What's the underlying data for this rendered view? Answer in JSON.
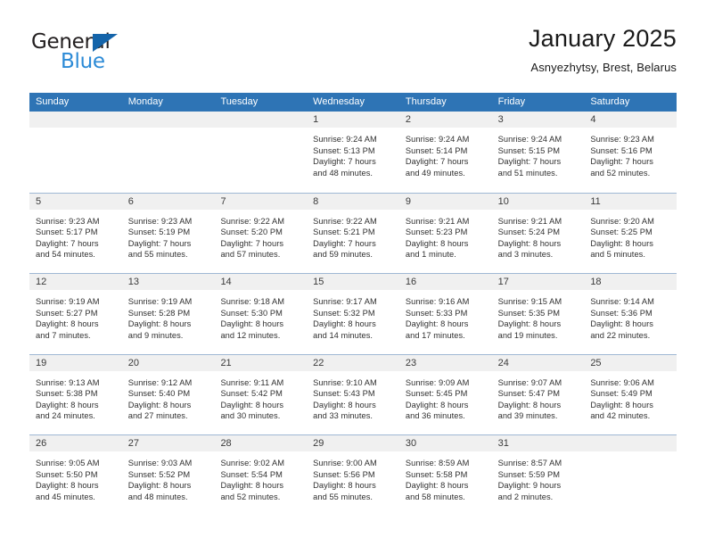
{
  "brand": {
    "name_part1": "General",
    "name_part2": "Blue",
    "triangle_color": "#1464aa",
    "blue_color": "#2b8ad6"
  },
  "header": {
    "title": "January 2025",
    "subtitle": "Asnyezhytsy, Brest, Belarus"
  },
  "theme": {
    "header_bar": "#2e74b5",
    "row_divider": "#9fb8d4",
    "daynum_strip": "#f0f0f0",
    "text": "#303030"
  },
  "weekdays": [
    "Sunday",
    "Monday",
    "Tuesday",
    "Wednesday",
    "Thursday",
    "Friday",
    "Saturday"
  ],
  "weeks": [
    {
      "days": [
        {
          "num": "",
          "lines": []
        },
        {
          "num": "",
          "lines": []
        },
        {
          "num": "",
          "lines": []
        },
        {
          "num": "1",
          "lines": [
            "Sunrise: 9:24 AM",
            "Sunset: 5:13 PM",
            "Daylight: 7 hours",
            "and 48 minutes."
          ]
        },
        {
          "num": "2",
          "lines": [
            "Sunrise: 9:24 AM",
            "Sunset: 5:14 PM",
            "Daylight: 7 hours",
            "and 49 minutes."
          ]
        },
        {
          "num": "3",
          "lines": [
            "Sunrise: 9:24 AM",
            "Sunset: 5:15 PM",
            "Daylight: 7 hours",
            "and 51 minutes."
          ]
        },
        {
          "num": "4",
          "lines": [
            "Sunrise: 9:23 AM",
            "Sunset: 5:16 PM",
            "Daylight: 7 hours",
            "and 52 minutes."
          ]
        }
      ]
    },
    {
      "days": [
        {
          "num": "5",
          "lines": [
            "Sunrise: 9:23 AM",
            "Sunset: 5:17 PM",
            "Daylight: 7 hours",
            "and 54 minutes."
          ]
        },
        {
          "num": "6",
          "lines": [
            "Sunrise: 9:23 AM",
            "Sunset: 5:19 PM",
            "Daylight: 7 hours",
            "and 55 minutes."
          ]
        },
        {
          "num": "7",
          "lines": [
            "Sunrise: 9:22 AM",
            "Sunset: 5:20 PM",
            "Daylight: 7 hours",
            "and 57 minutes."
          ]
        },
        {
          "num": "8",
          "lines": [
            "Sunrise: 9:22 AM",
            "Sunset: 5:21 PM",
            "Daylight: 7 hours",
            "and 59 minutes."
          ]
        },
        {
          "num": "9",
          "lines": [
            "Sunrise: 9:21 AM",
            "Sunset: 5:23 PM",
            "Daylight: 8 hours",
            "and 1 minute."
          ]
        },
        {
          "num": "10",
          "lines": [
            "Sunrise: 9:21 AM",
            "Sunset: 5:24 PM",
            "Daylight: 8 hours",
            "and 3 minutes."
          ]
        },
        {
          "num": "11",
          "lines": [
            "Sunrise: 9:20 AM",
            "Sunset: 5:25 PM",
            "Daylight: 8 hours",
            "and 5 minutes."
          ]
        }
      ]
    },
    {
      "days": [
        {
          "num": "12",
          "lines": [
            "Sunrise: 9:19 AM",
            "Sunset: 5:27 PM",
            "Daylight: 8 hours",
            "and 7 minutes."
          ]
        },
        {
          "num": "13",
          "lines": [
            "Sunrise: 9:19 AM",
            "Sunset: 5:28 PM",
            "Daylight: 8 hours",
            "and 9 minutes."
          ]
        },
        {
          "num": "14",
          "lines": [
            "Sunrise: 9:18 AM",
            "Sunset: 5:30 PM",
            "Daylight: 8 hours",
            "and 12 minutes."
          ]
        },
        {
          "num": "15",
          "lines": [
            "Sunrise: 9:17 AM",
            "Sunset: 5:32 PM",
            "Daylight: 8 hours",
            "and 14 minutes."
          ]
        },
        {
          "num": "16",
          "lines": [
            "Sunrise: 9:16 AM",
            "Sunset: 5:33 PM",
            "Daylight: 8 hours",
            "and 17 minutes."
          ]
        },
        {
          "num": "17",
          "lines": [
            "Sunrise: 9:15 AM",
            "Sunset: 5:35 PM",
            "Daylight: 8 hours",
            "and 19 minutes."
          ]
        },
        {
          "num": "18",
          "lines": [
            "Sunrise: 9:14 AM",
            "Sunset: 5:36 PM",
            "Daylight: 8 hours",
            "and 22 minutes."
          ]
        }
      ]
    },
    {
      "days": [
        {
          "num": "19",
          "lines": [
            "Sunrise: 9:13 AM",
            "Sunset: 5:38 PM",
            "Daylight: 8 hours",
            "and 24 minutes."
          ]
        },
        {
          "num": "20",
          "lines": [
            "Sunrise: 9:12 AM",
            "Sunset: 5:40 PM",
            "Daylight: 8 hours",
            "and 27 minutes."
          ]
        },
        {
          "num": "21",
          "lines": [
            "Sunrise: 9:11 AM",
            "Sunset: 5:42 PM",
            "Daylight: 8 hours",
            "and 30 minutes."
          ]
        },
        {
          "num": "22",
          "lines": [
            "Sunrise: 9:10 AM",
            "Sunset: 5:43 PM",
            "Daylight: 8 hours",
            "and 33 minutes."
          ]
        },
        {
          "num": "23",
          "lines": [
            "Sunrise: 9:09 AM",
            "Sunset: 5:45 PM",
            "Daylight: 8 hours",
            "and 36 minutes."
          ]
        },
        {
          "num": "24",
          "lines": [
            "Sunrise: 9:07 AM",
            "Sunset: 5:47 PM",
            "Daylight: 8 hours",
            "and 39 minutes."
          ]
        },
        {
          "num": "25",
          "lines": [
            "Sunrise: 9:06 AM",
            "Sunset: 5:49 PM",
            "Daylight: 8 hours",
            "and 42 minutes."
          ]
        }
      ]
    },
    {
      "days": [
        {
          "num": "26",
          "lines": [
            "Sunrise: 9:05 AM",
            "Sunset: 5:50 PM",
            "Daylight: 8 hours",
            "and 45 minutes."
          ]
        },
        {
          "num": "27",
          "lines": [
            "Sunrise: 9:03 AM",
            "Sunset: 5:52 PM",
            "Daylight: 8 hours",
            "and 48 minutes."
          ]
        },
        {
          "num": "28",
          "lines": [
            "Sunrise: 9:02 AM",
            "Sunset: 5:54 PM",
            "Daylight: 8 hours",
            "and 52 minutes."
          ]
        },
        {
          "num": "29",
          "lines": [
            "Sunrise: 9:00 AM",
            "Sunset: 5:56 PM",
            "Daylight: 8 hours",
            "and 55 minutes."
          ]
        },
        {
          "num": "30",
          "lines": [
            "Sunrise: 8:59 AM",
            "Sunset: 5:58 PM",
            "Daylight: 8 hours",
            "and 58 minutes."
          ]
        },
        {
          "num": "31",
          "lines": [
            "Sunrise: 8:57 AM",
            "Sunset: 5:59 PM",
            "Daylight: 9 hours",
            "and 2 minutes."
          ]
        },
        {
          "num": "",
          "lines": []
        }
      ]
    }
  ]
}
